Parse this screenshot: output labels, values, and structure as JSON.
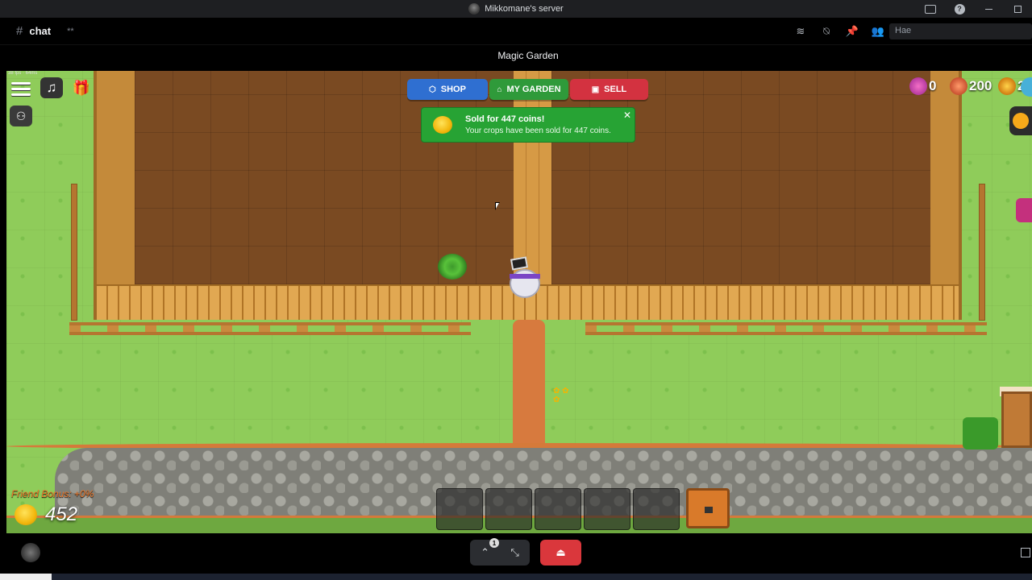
{
  "window": {
    "server_name": "Mikkomane's server"
  },
  "channel": {
    "hash": "#",
    "name": "chat",
    "extra": "**",
    "search_placeholder": "Hae"
  },
  "activity": {
    "title": "Magic Garden"
  },
  "hud": {
    "fps": "38 fps · 64ms",
    "nav": {
      "shop": "SHOP",
      "garden": "MY GARDEN",
      "sell": "SELL"
    },
    "toast": {
      "title": "Sold for 447 coins!",
      "message": "Your crops have been sold for 447 coins.",
      "close": "✕"
    },
    "currencies": [
      {
        "name": "pink-currency",
        "value": "0"
      },
      {
        "name": "bread-currency",
        "value": "200"
      },
      {
        "name": "gold-currency",
        "value": "2"
      }
    ],
    "friend_bonus": "Friend Bonus: +0%",
    "coins": "452",
    "hotbar_slots": 5
  },
  "controls": {
    "badge": "1",
    "expand": "⌃",
    "shrink": "⤡",
    "leave": "⏏"
  },
  "colors": {
    "shop": "#2f6fd1",
    "garden": "#2f9a3a",
    "sell": "#d33240",
    "toast": "#27a334",
    "friend_bonus": "#f27a2a"
  }
}
